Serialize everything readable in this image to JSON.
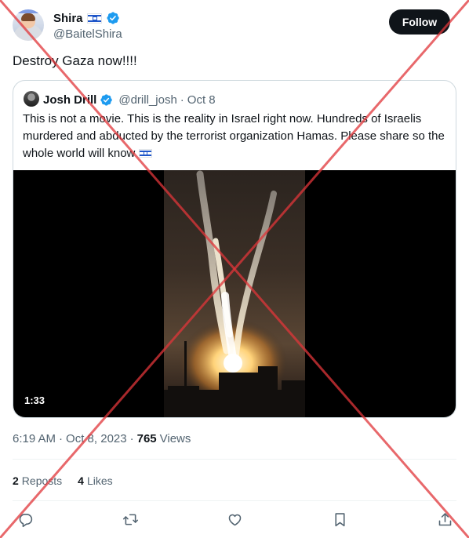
{
  "author": {
    "display_name": "Shira",
    "handle": "@BaitelShira",
    "follow_label": "Follow"
  },
  "tweet_text": "Destroy Gaza now!!!!",
  "quote": {
    "display_name": "Josh Drill",
    "handle": "@drill_josh",
    "separator": "·",
    "date": "Oct 8",
    "text": "This is not a movie. This is the reality in Israel right now. Hundreds of Israelis murdered and abducted by the terrorist organization Hamas. Please share so the whole world will know",
    "video_duration": "1:33"
  },
  "meta": {
    "time": "6:19 AM",
    "separator": "·",
    "date": "Oct 8, 2023",
    "views_count": "765",
    "views_label": "Views"
  },
  "stats": {
    "reposts_count": "2",
    "reposts_label": "Reposts",
    "likes_count": "4",
    "likes_label": "Likes"
  },
  "colors": {
    "text_primary": "#0f1419",
    "text_secondary": "#536471",
    "verified_blue": "#1d9bf0",
    "follow_bg": "#0f1419",
    "border": "#cfd9de",
    "cross_red": "#e0363a"
  },
  "icons": [
    "verified-badge-icon",
    "israel-flag-icon",
    "reply-icon",
    "repost-icon",
    "like-icon",
    "bookmark-icon",
    "share-icon"
  ]
}
